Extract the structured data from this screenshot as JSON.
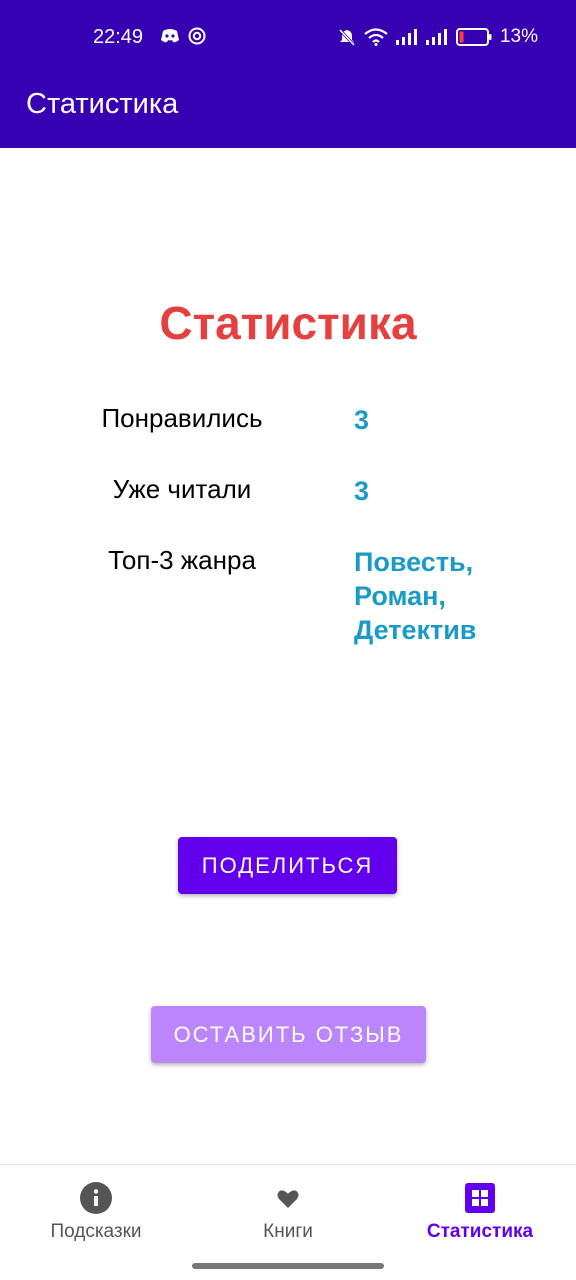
{
  "status_bar": {
    "time": "22:49",
    "battery_percent": "13%",
    "battery_level": 0.13,
    "icons": [
      "discord-icon",
      "vpn-icon",
      "mute-icon",
      "wifi-icon",
      "signal-icon",
      "signal-icon",
      "battery-icon"
    ]
  },
  "app_bar": {
    "title": "Статистика"
  },
  "content": {
    "heading": "Статистика",
    "stats": [
      {
        "label": "Понравились",
        "value": "3"
      },
      {
        "label": "Уже читали",
        "value": "3"
      },
      {
        "label": "Топ-3 жанра",
        "value_lines": [
          "Повесть,",
          "Роман,",
          "Детектив"
        ]
      }
    ],
    "share_button": "ПОДЕЛИТЬСЯ",
    "review_button": "ОСТАВИТЬ ОТЗЫВ"
  },
  "bottom_nav": {
    "items": [
      {
        "label": "Подсказки",
        "icon": "info-icon",
        "active": false
      },
      {
        "label": "Книги",
        "icon": "heart-icon",
        "active": false
      },
      {
        "label": "Статистика",
        "icon": "grid-icon",
        "active": true
      }
    ]
  },
  "colors": {
    "primary_dark": "#3700b3",
    "primary": "#6200ee",
    "accent_light": "#bb86fc",
    "heading_red": "#e53f3f",
    "value_blue": "#1a9ac7"
  }
}
